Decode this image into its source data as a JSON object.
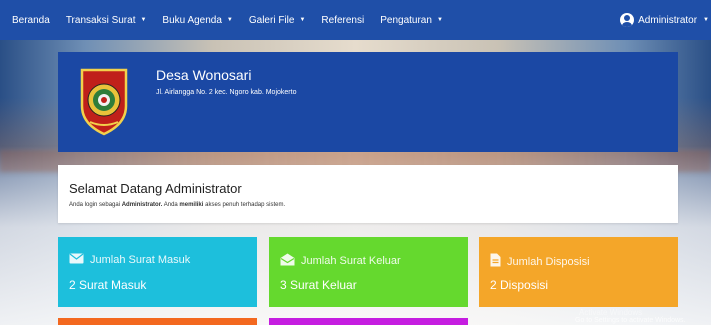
{
  "nav": {
    "items": [
      {
        "label": "Beranda",
        "caret": false
      },
      {
        "label": "Transaksi Surat",
        "caret": true
      },
      {
        "label": "Buku Agenda",
        "caret": true
      },
      {
        "label": "Galeri File",
        "caret": true
      },
      {
        "label": "Referensi",
        "caret": false
      },
      {
        "label": "Pengaturan",
        "caret": true
      }
    ],
    "user": {
      "label": "Administrator",
      "icon": "user-circle-icon"
    }
  },
  "header": {
    "name": "Desa Wonosari",
    "address": "Jl. Airlangga No. 2 kec. Ngoro kab. Mojokerto",
    "logo_icon": "district-emblem-icon"
  },
  "welcome": {
    "title": "Selamat Datang Administrator",
    "text_prefix": "Anda login sebagai ",
    "role": "Administrator.",
    "text_mid": " Anda ",
    "emphasis": "memiliki",
    "text_suffix": " akses penuh terhadap sistem."
  },
  "tiles": [
    {
      "title": "Jumlah Surat Masuk",
      "value": "2 Surat Masuk",
      "icon": "envelope-icon",
      "color": "#1dbfdc"
    },
    {
      "title": "Jumlah Surat Keluar",
      "value": "3 Surat Keluar",
      "icon": "envelope-open-icon",
      "color": "#65d92e"
    },
    {
      "title": "Jumlah Disposisi",
      "value": "2 Disposisi",
      "icon": "document-icon",
      "color": "#f4a629"
    }
  ],
  "colors": {
    "navbar": "#1f4fa8",
    "header_card": "#1b48a4",
    "bottom_left_tile": "#f3681f",
    "bottom_mid_tile": "#c51de0"
  },
  "watermark": {
    "line1": "Activate Windows",
    "line2": "Go to Settings to activate Windows."
  }
}
